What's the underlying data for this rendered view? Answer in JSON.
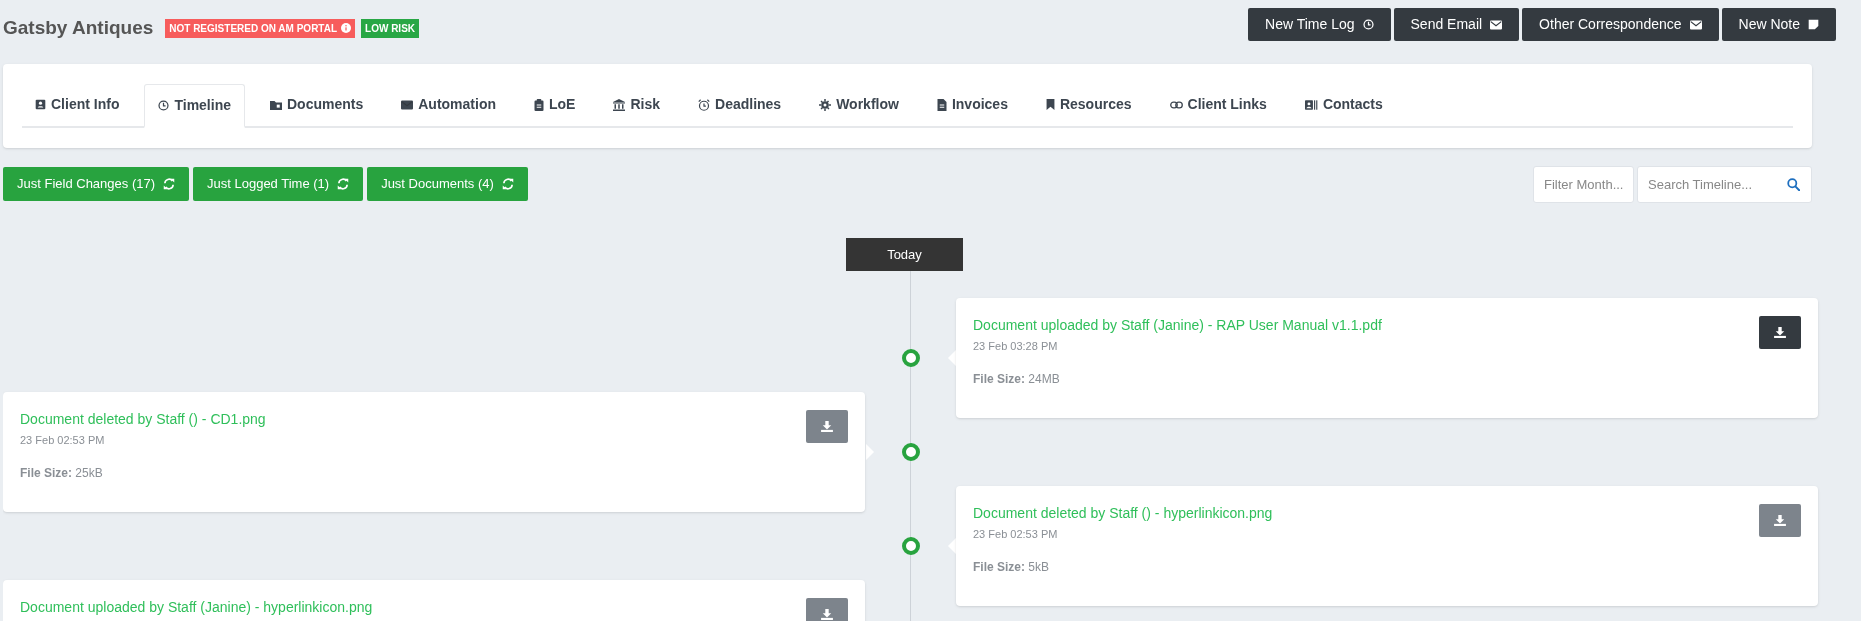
{
  "client": {
    "name": "Gatsby Antiques",
    "badges": [
      {
        "label": "NOT REGISTERED ON AM PORTAL",
        "color": "#f75c5c",
        "info": true
      },
      {
        "label": "LOW RISK",
        "color": "#28a745",
        "info": false
      }
    ]
  },
  "actions": [
    "New Time Log",
    "Send Email",
    "Other Correspondence",
    "New Note"
  ],
  "tabs": [
    {
      "label": "Client Info",
      "selected": false
    },
    {
      "label": "Timeline",
      "selected": true
    },
    {
      "label": "Documents",
      "selected": false
    },
    {
      "label": "Automation",
      "selected": false
    },
    {
      "label": "LoE",
      "selected": false
    },
    {
      "label": "Risk",
      "selected": false
    },
    {
      "label": "Deadlines",
      "selected": false
    },
    {
      "label": "Workflow",
      "selected": false
    },
    {
      "label": "Invoices",
      "selected": false
    },
    {
      "label": "Resources",
      "selected": false
    },
    {
      "label": "Client Links",
      "selected": false
    },
    {
      "label": "Contacts",
      "selected": false
    }
  ],
  "filters": [
    "Just Field Changes (17)",
    "Just Logged Time (1)",
    "Just Documents (4)"
  ],
  "filter_month": {
    "placeholder": "Filter Month..."
  },
  "search": {
    "placeholder": "Search Timeline..."
  },
  "timeline": {
    "marker": "Today",
    "items": [
      {
        "title": "Document uploaded by Staff (Janine) - RAP User Manual v1.1.pdf",
        "time": "23 Feb 03:28 PM",
        "size_label": "File Size:",
        "size": "24MB",
        "download_active": true
      },
      {
        "title": "Document deleted by Staff () - CD1.png",
        "time": "23 Feb 02:53 PM",
        "size_label": "File Size:",
        "size": "25kB",
        "download_active": false
      },
      {
        "title": "Document deleted by Staff () - hyperlinkicon.png",
        "time": "23 Feb 02:53 PM",
        "size_label": "File Size:",
        "size": "5kB",
        "download_active": false
      },
      {
        "title": "Document uploaded by Staff (Janine) - hyperlinkicon.png",
        "download_active": false
      }
    ]
  }
}
